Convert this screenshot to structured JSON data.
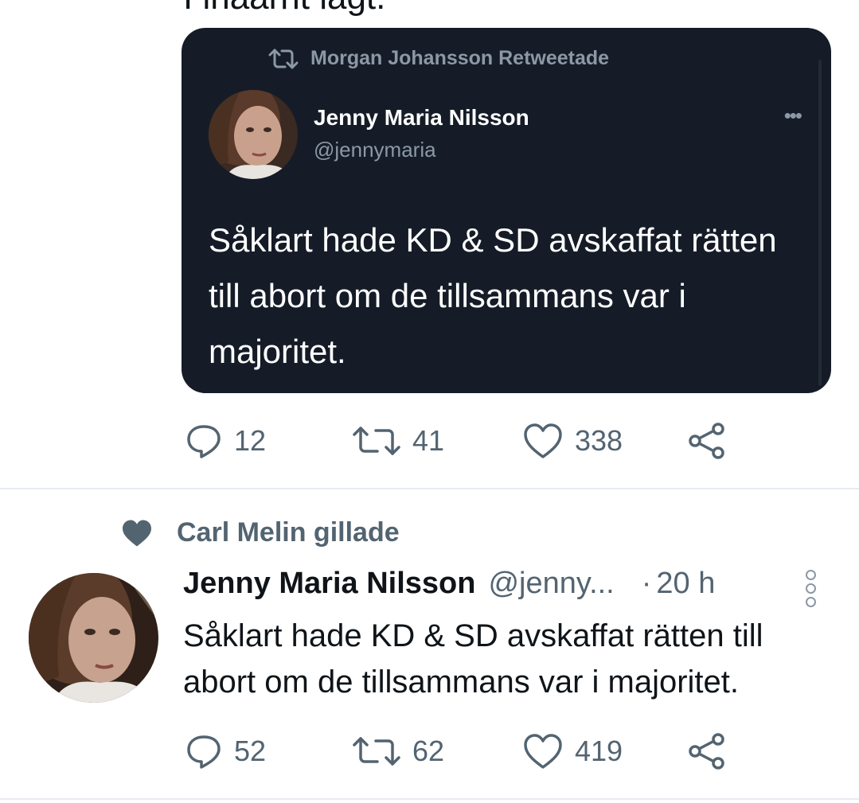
{
  "top_cutoff_text": "I inaarht lagt.",
  "embedded_card": {
    "retweet_label": "Morgan Johansson Retweetade",
    "author_name": "Jenny Maria Nilsson",
    "author_handle": "@jennymaria",
    "more_glyph": "•••",
    "text": "Såklart hade KD & SD avskaffat rätten till abort om de tillsammans var i majoritet."
  },
  "tweet1_actions": {
    "replies": "12",
    "retweets": "41",
    "likes": "338"
  },
  "tweet2": {
    "social_context": "Carl Melin gillade",
    "author_name": "Jenny Maria Nilsson",
    "author_handle": "@jenny...",
    "dot": "·",
    "time": "20 h",
    "text": "Såklart hade KD & SD avskaffat rätten till abort om de tillsammans var i majoritet.",
    "actions": {
      "replies": "52",
      "retweets": "62",
      "likes": "419"
    }
  },
  "colors": {
    "dark_card_bg": "#151c27",
    "secondary_text": "#536471",
    "divider": "#e6ecf0"
  }
}
